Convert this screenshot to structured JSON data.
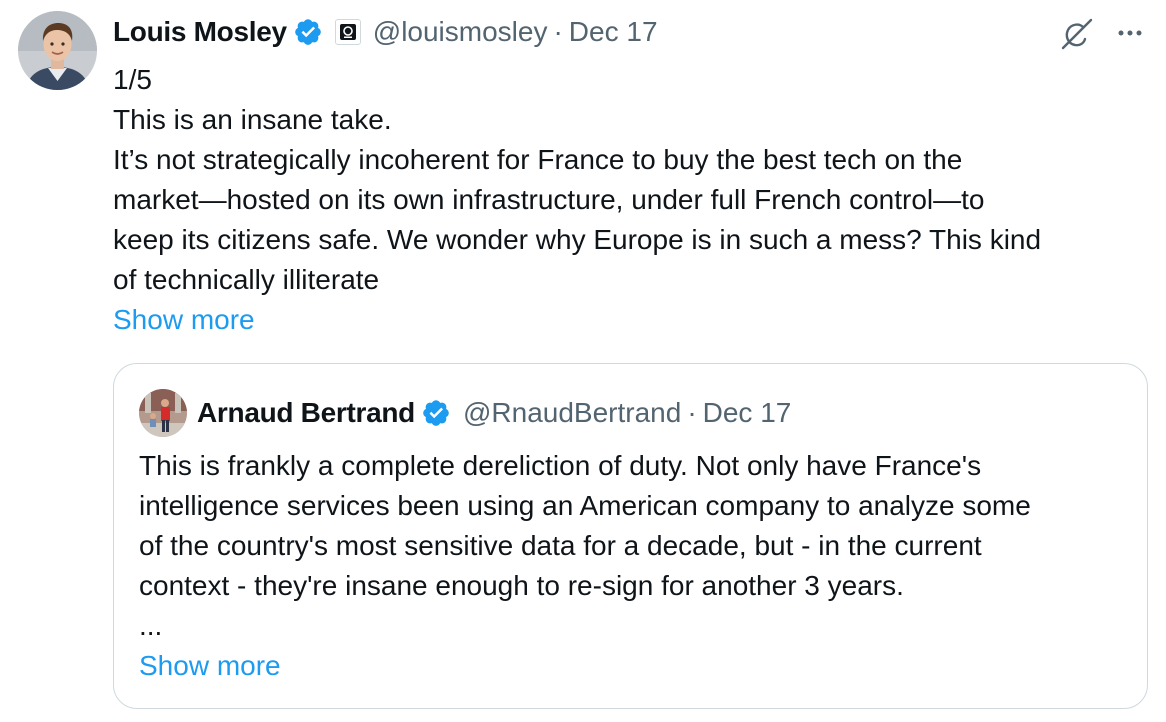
{
  "post": {
    "author": {
      "display_name": "Louis Mosley",
      "handle": "@louismosley",
      "verified_icon": "verified-badge-icon",
      "affiliate_icon": "affiliate-badge-icon"
    },
    "separator": "·",
    "date": "Dec 17",
    "actions": {
      "grok_icon": "grok-icon",
      "more_icon": "more-options-icon"
    },
    "lines": [
      "1/5",
      "This is an insane take.",
      "It’s not strategically incoherent for France to buy the best tech on the",
      "market—hosted on its own infrastructure, under full French control—to",
      "keep its citizens safe. We wonder why Europe is in such a mess? This kind",
      "of technically illiterate"
    ],
    "show_more": "Show more"
  },
  "quote": {
    "author": {
      "display_name": "Arnaud Bertrand",
      "handle": "@RnaudBertrand",
      "verified_icon": "verified-badge-icon"
    },
    "separator": "·",
    "date": "Dec 17",
    "lines": [
      "This is frankly a complete dereliction of duty. Not only have France's",
      "intelligence services been using an American company to analyze some",
      "of the country's most sensitive data for a decade, but - in the current",
      "context - they're insane enough to re-sign for another 3 years.",
      "..."
    ],
    "show_more": "Show more"
  },
  "colors": {
    "text": "#0f1419",
    "secondary": "#536471",
    "link": "#1d9bf0",
    "verified": "#1d9bf0",
    "border": "#cfd9de"
  }
}
